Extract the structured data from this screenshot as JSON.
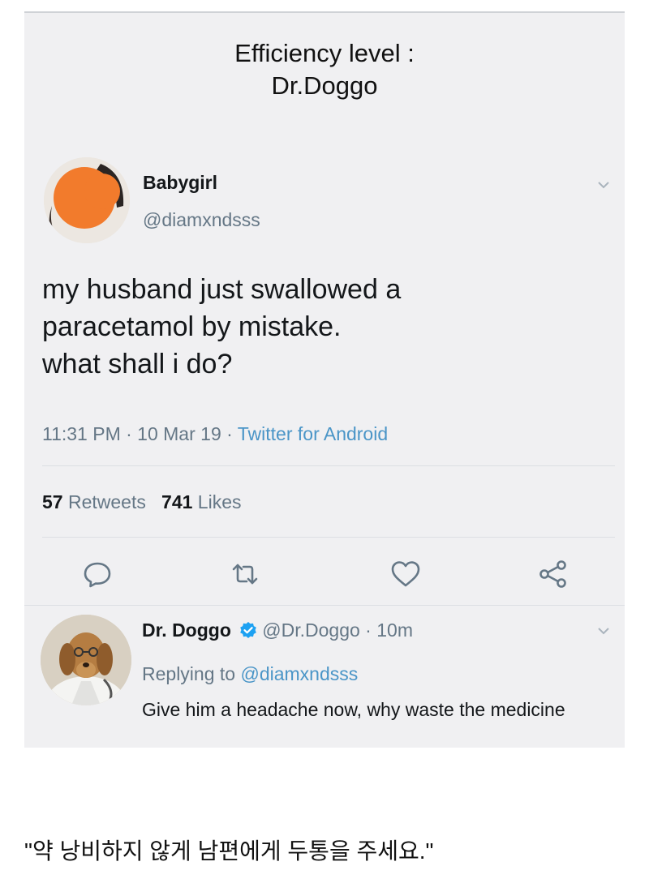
{
  "caption": {
    "title": "Efficiency level :\nDr.Doggo"
  },
  "tweet": {
    "display_name": "Babygirl",
    "handle": "@diamxndsss",
    "text": "my husband just swallowed a\nparacetamol by mistake.\nwhat shall i do?",
    "time_date": "11:31 PM · 10 Mar 19 · ",
    "source": "Twitter for Android",
    "retweets_count": "57",
    "retweets_label": "Retweets",
    "likes_count": "741",
    "likes_label": "Likes",
    "actions": [
      "reply-icon",
      "retweet-icon",
      "like-icon",
      "share-icon"
    ]
  },
  "reply": {
    "display_name": "Dr. Doggo",
    "handle_time": "@Dr.Doggo · 10m",
    "replying_prefix": "Replying to ",
    "replying_to": "@diamxndsss",
    "text": "Give him a headache now, why waste the medicine"
  },
  "footer": {
    "korean_caption": "\"약 낭비하지 않게 남편에게 두통을 주세요.\""
  },
  "colors": {
    "link": "#4a95c7",
    "muted": "#657786",
    "verified": "#1da1f2",
    "background": "#f0f0f2"
  }
}
